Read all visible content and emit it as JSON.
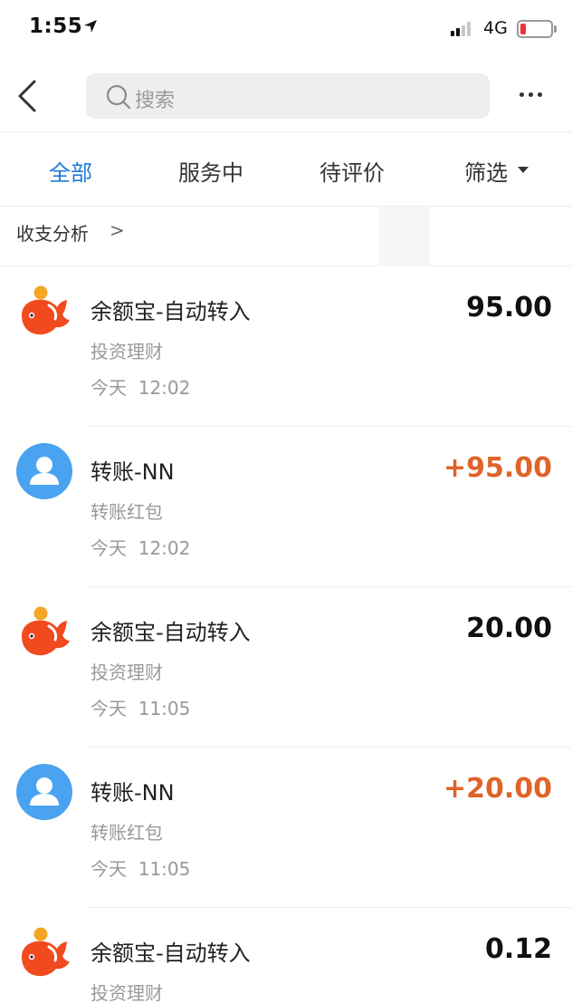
{
  "status_bar": {
    "time": "1:55",
    "network": "4G"
  },
  "nav": {
    "search_placeholder": "搜索"
  },
  "tabs": [
    {
      "label": "全部",
      "active": true
    },
    {
      "label": "服务中",
      "active": false
    },
    {
      "label": "待评价",
      "active": false
    },
    {
      "label": "筛选",
      "active": false
    }
  ],
  "analysis": {
    "label": "收支分析",
    "chevron": ">"
  },
  "transactions": [
    {
      "title": "余额宝-自动转入",
      "category": "投资理财",
      "day": "今天",
      "time": "12:02",
      "amount": "95.00",
      "icon": "yuebao-icon"
    },
    {
      "title": "转账-NN",
      "category": "转账红包",
      "day": "今天",
      "time": "12:02",
      "amount": "+95.00",
      "icon": "user-avatar-icon"
    },
    {
      "title": "余额宝-自动转入",
      "category": "投资理财",
      "day": "今天",
      "time": "11:05",
      "amount": "20.00",
      "icon": "yuebao-icon"
    },
    {
      "title": "转账-NN",
      "category": "转账红包",
      "day": "今天",
      "time": "11:05",
      "amount": "+20.00",
      "icon": "user-avatar-icon"
    },
    {
      "title": "余额宝-自动转入",
      "category": "投资理财",
      "day": "",
      "time": "",
      "amount": "0.12",
      "icon": "yuebao-icon"
    }
  ],
  "colors": {
    "accent": "#1c7bd8",
    "income": "#e0632a",
    "yuebao": "#f04a1e",
    "avatar": "#4aa3f0"
  }
}
